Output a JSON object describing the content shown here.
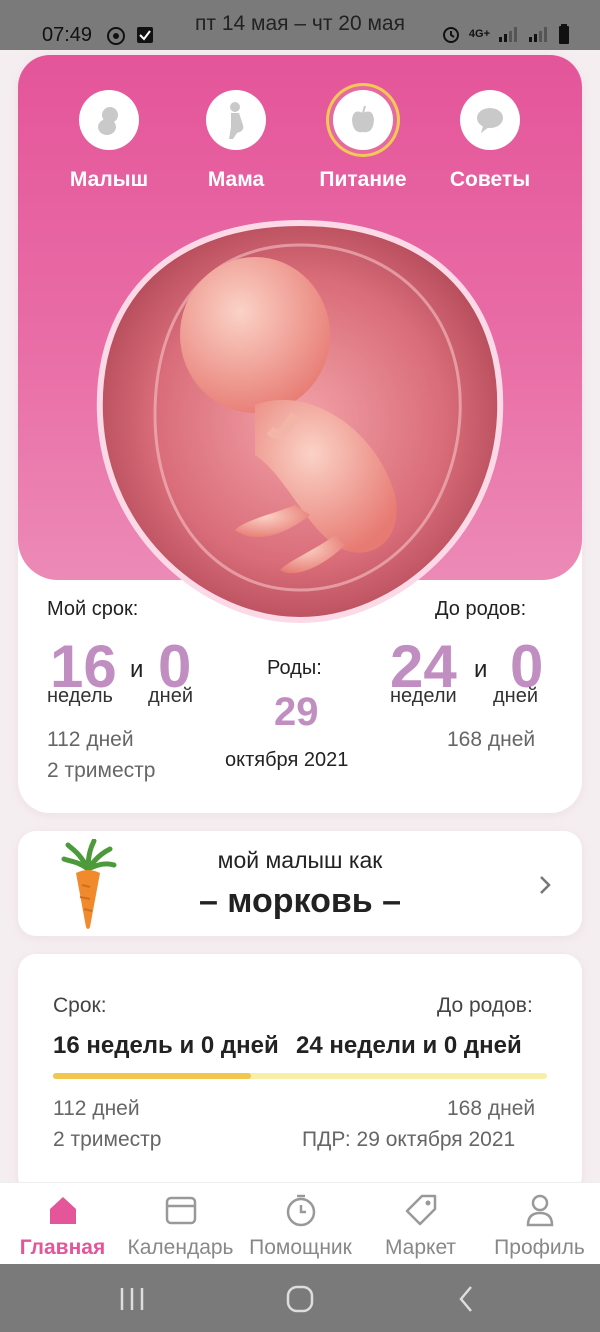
{
  "status": {
    "time": "07:49",
    "range": "пт 14 мая – чт 20 мая",
    "network": "4G+"
  },
  "tabs": [
    {
      "label": "Малыш",
      "icon": "baby-icon"
    },
    {
      "label": "Мама",
      "icon": "pregnant-mother-icon"
    },
    {
      "label": "Питание",
      "icon": "apple-icon",
      "active": true
    },
    {
      "label": "Советы",
      "icon": "chat-bubble-icon"
    }
  ],
  "term": {
    "my_term_label": "Мой срок:",
    "weeks": "16",
    "and": "и",
    "days": "0",
    "weeks_word": "недель",
    "days_word": "дней",
    "total_days": "112 дней",
    "trimester": "2 триместр"
  },
  "birth": {
    "label": "Роды:",
    "day": "29",
    "month_year": "октября 2021"
  },
  "remaining": {
    "label": "До родов:",
    "weeks": "24",
    "and": "и",
    "days": "0",
    "weeks_word": "недели",
    "days_word": "дней",
    "total_days": "168 дней"
  },
  "fruit": {
    "title": "мой малыш как",
    "name": "– морковь –"
  },
  "progress": {
    "left_label": "Срок:",
    "right_label": "До родов:",
    "left_value": "16 недель и 0 дней",
    "right_value": "24 недели и 0 дней",
    "fraction": 0.4,
    "left_days": "112 дней",
    "trimester": "2 триместр",
    "right_days": "168 дней",
    "due_date": "ПДР: 29 октября 2021"
  },
  "bottom_nav": [
    {
      "label": "Главная",
      "icon": "home-icon",
      "active": true
    },
    {
      "label": "Календарь",
      "icon": "calendar-icon"
    },
    {
      "label": "Помощник",
      "icon": "stopwatch-icon"
    },
    {
      "label": "Маркет",
      "icon": "tag-icon"
    },
    {
      "label": "Профиль",
      "icon": "profile-icon"
    }
  ],
  "colors": {
    "pink": "#e4559a",
    "lilac": "#c08ec0",
    "progress_fill": "#f0c64c",
    "progress_track": "#f8efa6"
  }
}
